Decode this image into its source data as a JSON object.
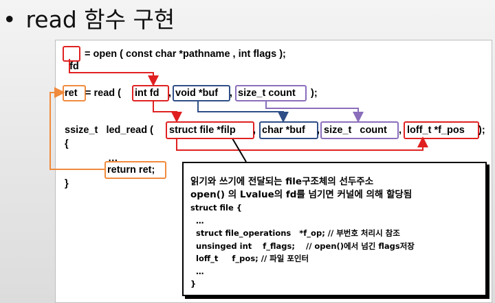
{
  "title": {
    "bullet": "•",
    "text": "read 함수 구현"
  },
  "code": {
    "line1": {
      "fd": "fd",
      "rest": "= open ( const char *pathname , int flags );"
    },
    "line2": {
      "ret": "ret",
      "mid": "= read (",
      "int_fd": "int fd",
      "comma1": ",",
      "void_buf": "void *buf",
      "comma2": ",",
      "size_t_count": "size_t count",
      "close": ");"
    },
    "line3": {
      "decl": "ssize_t   led_read (",
      "struct_file": "struct file *filp",
      "comma1": ",",
      "char_buf": "char *buf",
      "comma2": ",",
      "size_t_count": "size_t   count",
      "comma3": ",",
      "loff_t": "loff_t *f_pos",
      "close": ");"
    },
    "open_brace": "{",
    "ellipsis": "…",
    "return_ret": "return ret;",
    "close_brace": "}"
  },
  "note": {
    "line1": "읽기와 쓰기에 전달되는 file구조체의 선두주소",
    "line2": "open() 의 Lvalue의 fd를 넘기면 커널에 의해 할당됨",
    "line3": "struct file {",
    "line4": "  …",
    "line5": "  struct file_operations   *f_op; // 부번호 처리시 참조",
    "line6": "  unsinged int    f_flags;    // open()에서 넘긴 flags저장",
    "line7": "  loff_t     f_pos; // 파일 포인터",
    "line8": "  …",
    "line9": "}"
  },
  "colors": {
    "red": "#e02020",
    "blue": "#2e4d86",
    "purple": "#8a6dbb",
    "orange": "#f08a3c"
  }
}
